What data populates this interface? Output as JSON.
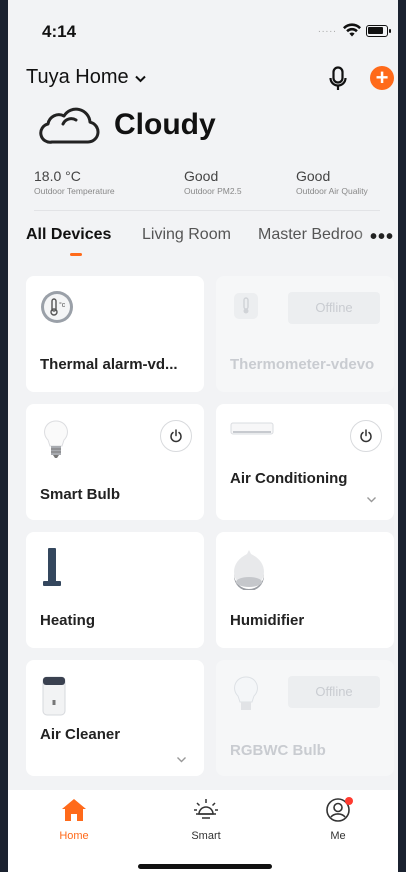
{
  "status_bar": {
    "time": "4:14",
    "signal": "....."
  },
  "header": {
    "home_name": "Tuya Home"
  },
  "weather": {
    "condition": "Cloudy",
    "metrics": [
      {
        "value": "18.0 °C",
        "label": "Outdoor Temperature"
      },
      {
        "value": "Good",
        "label": "Outdoor PM2.5"
      },
      {
        "value": "Good",
        "label": "Outdoor Air Quality"
      }
    ]
  },
  "tabs": [
    "All Devices",
    "Living Room",
    "Master Bedroo"
  ],
  "devices": [
    {
      "name": "Thermal alarm-vd...",
      "icon": "thermal-alarm-icon",
      "status": "online"
    },
    {
      "name": "Thermometer-vdevo",
      "icon": "thermometer-icon",
      "status": "Offline"
    },
    {
      "name": "Smart Bulb",
      "icon": "bulb-icon",
      "status": "online"
    },
    {
      "name": "Air Conditioning",
      "icon": "air-conditioner-icon",
      "status": "online"
    },
    {
      "name": "Heating",
      "icon": "heater-icon",
      "status": "online"
    },
    {
      "name": "Humidifier",
      "icon": "humidifier-icon",
      "status": "online"
    },
    {
      "name": "Air Cleaner",
      "icon": "air-cleaner-icon",
      "status": "online"
    },
    {
      "name": "RGBWC Bulb",
      "icon": "rgb-bulb-icon",
      "status": "Offline"
    }
  ],
  "bottom_nav": [
    {
      "label": "Home",
      "icon": "home-icon",
      "active": true
    },
    {
      "label": "Smart",
      "icon": "sun-icon",
      "active": false
    },
    {
      "label": "Me",
      "icon": "user-icon",
      "active": false,
      "badge": true
    }
  ],
  "colors": {
    "accent": "#ff6a1a",
    "background": "#f2f3f5",
    "card": "#ffffff",
    "offline_text": "#c9ccd1"
  }
}
